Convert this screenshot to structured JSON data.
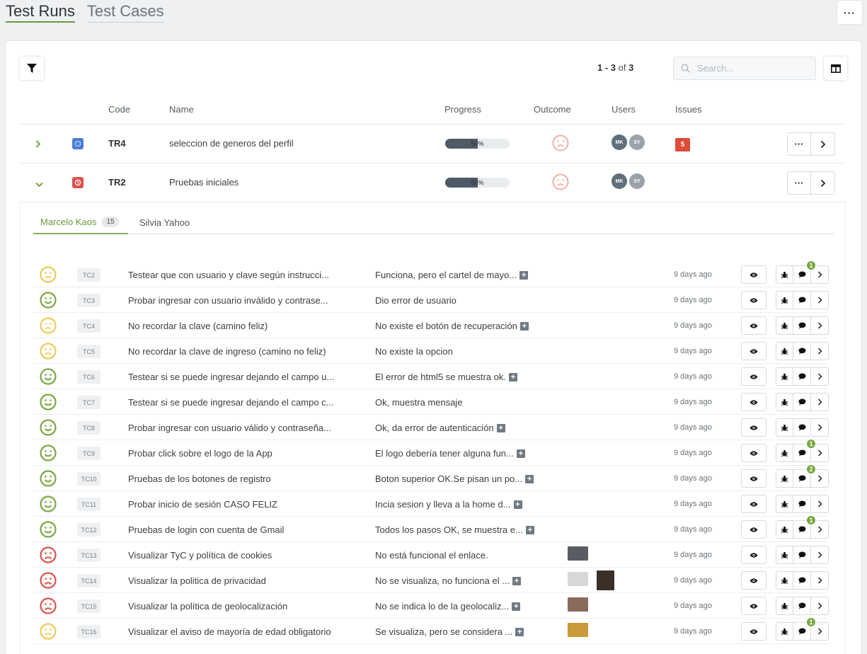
{
  "top_tabs": [
    {
      "label": "Test Runs"
    },
    {
      "label": "Test Cases"
    }
  ],
  "toolbar": {
    "more_label": "···",
    "pager": {
      "range": "1 - 3",
      "of": "of",
      "total": "3"
    },
    "search": {
      "placeholder": "Search..."
    }
  },
  "table": {
    "headers": {
      "code": "Code",
      "name": "Name",
      "progress": "Progress",
      "outcome": "Outcome",
      "users": "Users",
      "issues": "Issues"
    },
    "runs": [
      {
        "code": "TR4",
        "name": "seleccion de generos del perfil",
        "progress": 50,
        "progress_label": "50%",
        "status": "in-progress",
        "outcome": "sad",
        "users": [
          "MK",
          "SY"
        ],
        "issues": "5",
        "expanded": false
      },
      {
        "code": "TR2",
        "name": "Pruebas iniciales",
        "progress": 50,
        "progress_label": "50%",
        "status": "scheduled",
        "outcome": "sad",
        "users": [
          "MK",
          "SY"
        ],
        "issues": "",
        "expanded": true
      }
    ],
    "more_label": "···"
  },
  "expanded": {
    "tabs": [
      {
        "label": "Marcelo Kaos",
        "count": "15"
      },
      {
        "label": "Silvia Yahoo"
      }
    ],
    "cases": [
      {
        "code": "TC2",
        "face": "neutral",
        "name": "Testear que con usuario y clave según instrucci...",
        "result": "Funciona, pero el cartel de mayo...",
        "plus": true,
        "time": "9 days ago",
        "comments": "1",
        "thumbs": []
      },
      {
        "code": "TC3",
        "face": "happy",
        "name": "Probar ingresar con usuario inválido y contrase...",
        "result": "Dio error de usuario",
        "plus": false,
        "time": "9 days ago",
        "comments": "",
        "thumbs": []
      },
      {
        "code": "TC4",
        "face": "neutral",
        "name": "No recordar la clave (camino feliz)",
        "result": "No existe el botón de recuperación",
        "plus": true,
        "time": "9 days ago",
        "comments": "",
        "thumbs": []
      },
      {
        "code": "TC5",
        "face": "neutral",
        "name": "No recordar la clave de ingreso (camino no feliz)",
        "result": "No existe la opcion",
        "plus": false,
        "time": "9 days ago",
        "comments": "",
        "thumbs": []
      },
      {
        "code": "TC6",
        "face": "happy",
        "name": "Testear si se puede ingresar dejando el campo u...",
        "result": "El error de html5 se muestra ok.",
        "plus": true,
        "time": "9 days ago",
        "comments": "",
        "thumbs": []
      },
      {
        "code": "TC7",
        "face": "happy",
        "name": "Testear si se puede ingresar dejando el campo c...",
        "result": "Ok, muestra mensaje",
        "plus": false,
        "time": "9 days ago",
        "comments": "",
        "thumbs": []
      },
      {
        "code": "TC8",
        "face": "happy",
        "name": "Probar ingresar con usuario válido y contraseña...",
        "result": "Ok, da error de autenticación",
        "plus": true,
        "time": "9 days ago",
        "comments": "",
        "thumbs": []
      },
      {
        "code": "TC9",
        "face": "happy",
        "name": "Probar click sobre el logo de la App",
        "result": "El logo debería tener alguna fun...",
        "plus": true,
        "time": "9 days ago",
        "comments": "1",
        "thumbs": []
      },
      {
        "code": "TC10",
        "face": "happy",
        "name": "Pruebas de los botones de registro",
        "result": "Boton superior OK.Se pisan un po...",
        "plus": true,
        "time": "9 days ago",
        "comments": "2",
        "thumbs": []
      },
      {
        "code": "TC11",
        "face": "happy",
        "name": "Probar inicio de sesión CASO FELIZ",
        "result": "Incia sesion y lleva a la home d...",
        "plus": true,
        "time": "9 days ago",
        "comments": "",
        "thumbs": []
      },
      {
        "code": "TC12",
        "face": "happy",
        "name": "Pruebas de login con cuenta de Gmail",
        "result": "Todos los pasos OK, se muestra e...",
        "plus": true,
        "time": "9 days ago",
        "comments": "1",
        "thumbs": []
      },
      {
        "code": "TC13",
        "face": "sad",
        "name": "Visualizar TyC y política de cookies",
        "result": "No está funcional el enlace.",
        "plus": false,
        "time": "9 days ago",
        "comments": "",
        "thumbs": [
          "#5a5c64"
        ]
      },
      {
        "code": "TC14",
        "face": "sad",
        "name": "Visualizar la politica de privacidad",
        "result": "No se visualiza, no funciona el ...",
        "plus": true,
        "time": "9 days ago",
        "comments": "",
        "thumbs": [
          "#d8d8d8",
          "#3a3028"
        ]
      },
      {
        "code": "TC15",
        "face": "sad",
        "name": "Visualizar la política de geolocalización",
        "result": "No se indica lo de la geolocaliz...",
        "plus": true,
        "time": "9 days ago",
        "comments": "",
        "thumbs": [
          "#8a6a5a"
        ]
      },
      {
        "code": "TC16",
        "face": "neutral",
        "name": "Visualizar el aviso de mayoría de edad obligatorio",
        "result": "Se visualiza, pero se considera ...",
        "plus": true,
        "time": "9 days ago",
        "comments": "1",
        "thumbs": [
          "#c99a3a"
        ]
      }
    ]
  },
  "colors": {
    "accent": "#79a843",
    "happy": "#79a843",
    "neutral": "#f0c85a",
    "sad": "#d9534f",
    "danger": "#dd4b39",
    "avatar_mk": "#5f6f7c",
    "avatar_sy": "#9aa3ab"
  }
}
